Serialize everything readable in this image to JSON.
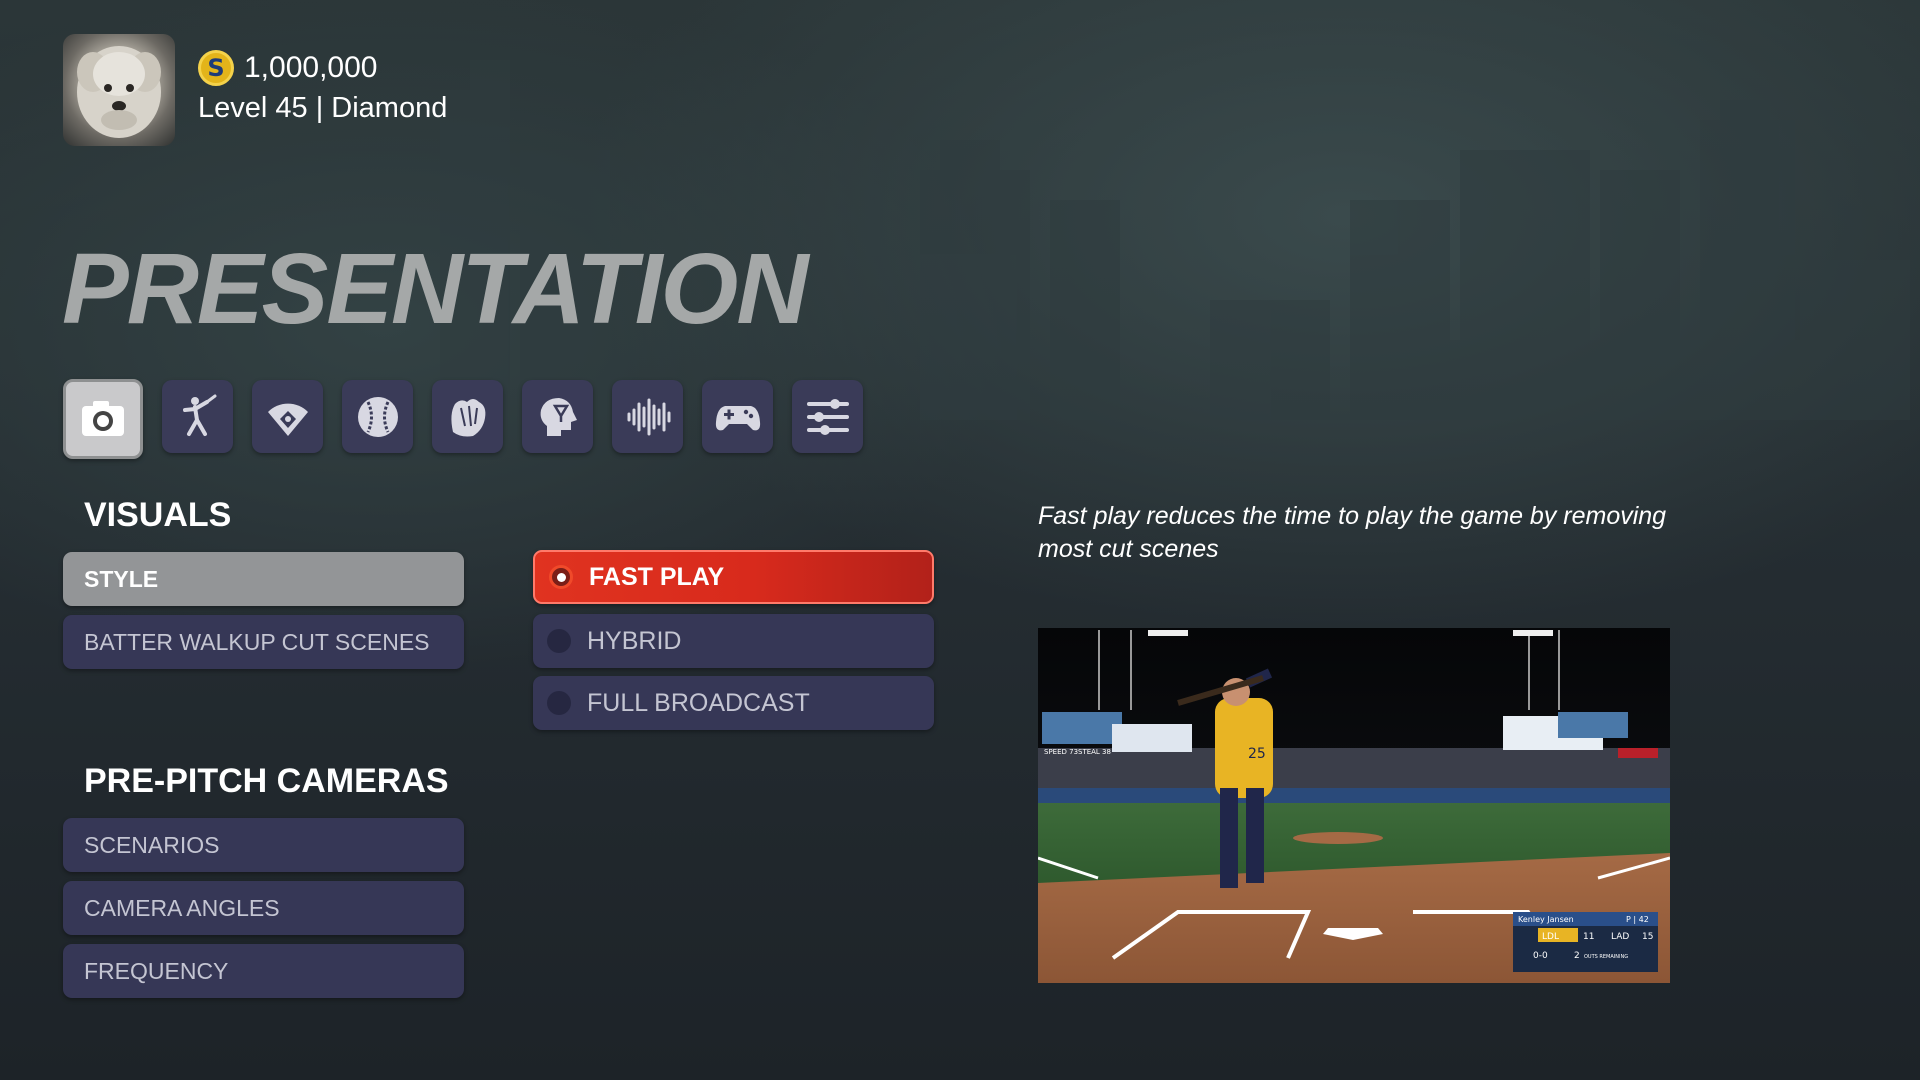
{
  "profile": {
    "coins": "1,000,000",
    "coin_symbol": "S",
    "level_text": "Level 45 | Diamond"
  },
  "page_title": "PRESENTATION",
  "categories": [
    {
      "icon": "camera-icon",
      "active": true
    },
    {
      "icon": "batter-icon",
      "active": false
    },
    {
      "icon": "baseball-diamond-icon",
      "active": false
    },
    {
      "icon": "baseball-icon",
      "active": false
    },
    {
      "icon": "glove-icon",
      "active": false
    },
    {
      "icon": "head-thought-icon",
      "active": false
    },
    {
      "icon": "audio-wave-icon",
      "active": false
    },
    {
      "icon": "gamepad-icon",
      "active": false
    },
    {
      "icon": "sliders-icon",
      "active": false
    }
  ],
  "visuals": {
    "heading": "VISUALS",
    "items": [
      {
        "label": "STYLE",
        "selected": true
      },
      {
        "label": "BATTER WALKUP CUT SCENES",
        "selected": false
      }
    ]
  },
  "pre_pitch": {
    "heading": "PRE-PITCH CAMERAS",
    "items": [
      {
        "label": "SCENARIOS"
      },
      {
        "label": "CAMERA ANGLES"
      },
      {
        "label": "FREQUENCY"
      }
    ]
  },
  "style_options": [
    {
      "label": "FAST PLAY",
      "selected": true
    },
    {
      "label": "HYBRID",
      "selected": false
    },
    {
      "label": "FULL BROADCAST",
      "selected": false
    }
  ],
  "description": "Fast play reduces the time to play the game by removing most cut scenes",
  "preview": {
    "jersey_number": "25",
    "scorebug": {
      "pitcher": "Kenley Jansen",
      "pitch_count": "P | 42",
      "away_team": "LDL",
      "away_score": "11",
      "home_team": "LAD",
      "home_score": "15",
      "count": "0-0",
      "outs": "2",
      "outs_label": "OUTS REMAINING"
    },
    "speed_text": "SPEED 73",
    "steal_text": "STEAL 38"
  },
  "colors": {
    "accent_red": "#e03320",
    "button_bg": "#363756",
    "selected_grey": "#939597",
    "title_grey": "#a5a8a8"
  }
}
